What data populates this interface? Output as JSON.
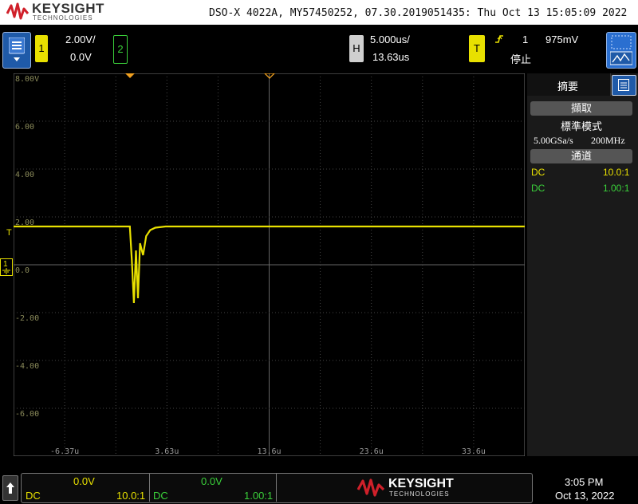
{
  "header": {
    "brand": "KEYSIGHT",
    "brand_sub": "TECHNOLOGIES",
    "title": "DSO-X 4022A, MY57450252, 07.30.2019051435: Thu Oct 13 15:05:09 2022"
  },
  "controls": {
    "ch1": {
      "label": "1",
      "scale": "2.00V/",
      "offset": "0.0V",
      "color": "#e8e000"
    },
    "ch2": {
      "label": "2",
      "color": "#3ad13a"
    },
    "horizontal": {
      "label": "H",
      "timebase": "5.000us/",
      "delay": "13.63us"
    },
    "trigger": {
      "label": "T",
      "source": "1",
      "level": "975mV",
      "status": "停止",
      "slope_icon": "rising-edge-icon"
    }
  },
  "graticule": {
    "y_labels": [
      "8.00V",
      "6.00",
      "4.00",
      "2.00",
      "0.0",
      "-2.00",
      "-4.00",
      "-6.00"
    ],
    "x_labels": [
      "-6.37u",
      "3.63u",
      "13.6u",
      "23.6u",
      "33.6u"
    ],
    "ch1_marker": "1",
    "trig_marker": "T"
  },
  "side_panel": {
    "tab": "摘要",
    "acquire_btn": "擷取",
    "mode": "標準模式",
    "sample_rate": "5.00GSa/s",
    "bandwidth": "200MHz",
    "channels_btn": "通道",
    "ch1_coupling": "DC",
    "ch1_probe": "10.0:1",
    "ch2_coupling": "DC",
    "ch2_probe": "1.00:1"
  },
  "bottom": {
    "ch1_offset": "0.0V",
    "ch1_coupling": "DC",
    "ch1_probe": "10.0:1",
    "ch2_offset": "0.0V",
    "ch2_coupling": "DC",
    "ch2_probe": "1.00:1",
    "brand": "KEYSIGHT",
    "brand_sub": "TECHNOLOGIES",
    "time": "3:05 PM",
    "date": "Oct 13, 2022"
  },
  "chart_data": {
    "type": "line",
    "xlabel": "",
    "ylabel": "",
    "xlim": [
      -11.37,
      38.63
    ],
    "ylim": [
      -8,
      8
    ],
    "series": [
      {
        "x": [
          -11.37,
          0,
          0.2,
          0.4,
          0.6,
          0.8,
          1.0,
          1.3,
          1.6,
          2.0,
          2.5,
          3.5,
          38.63
        ],
        "values": [
          1.6,
          1.6,
          0.2,
          -1.6,
          0.6,
          -1.4,
          0.9,
          0.4,
          1.2,
          1.45,
          1.55,
          1.6,
          1.6
        ]
      }
    ]
  }
}
